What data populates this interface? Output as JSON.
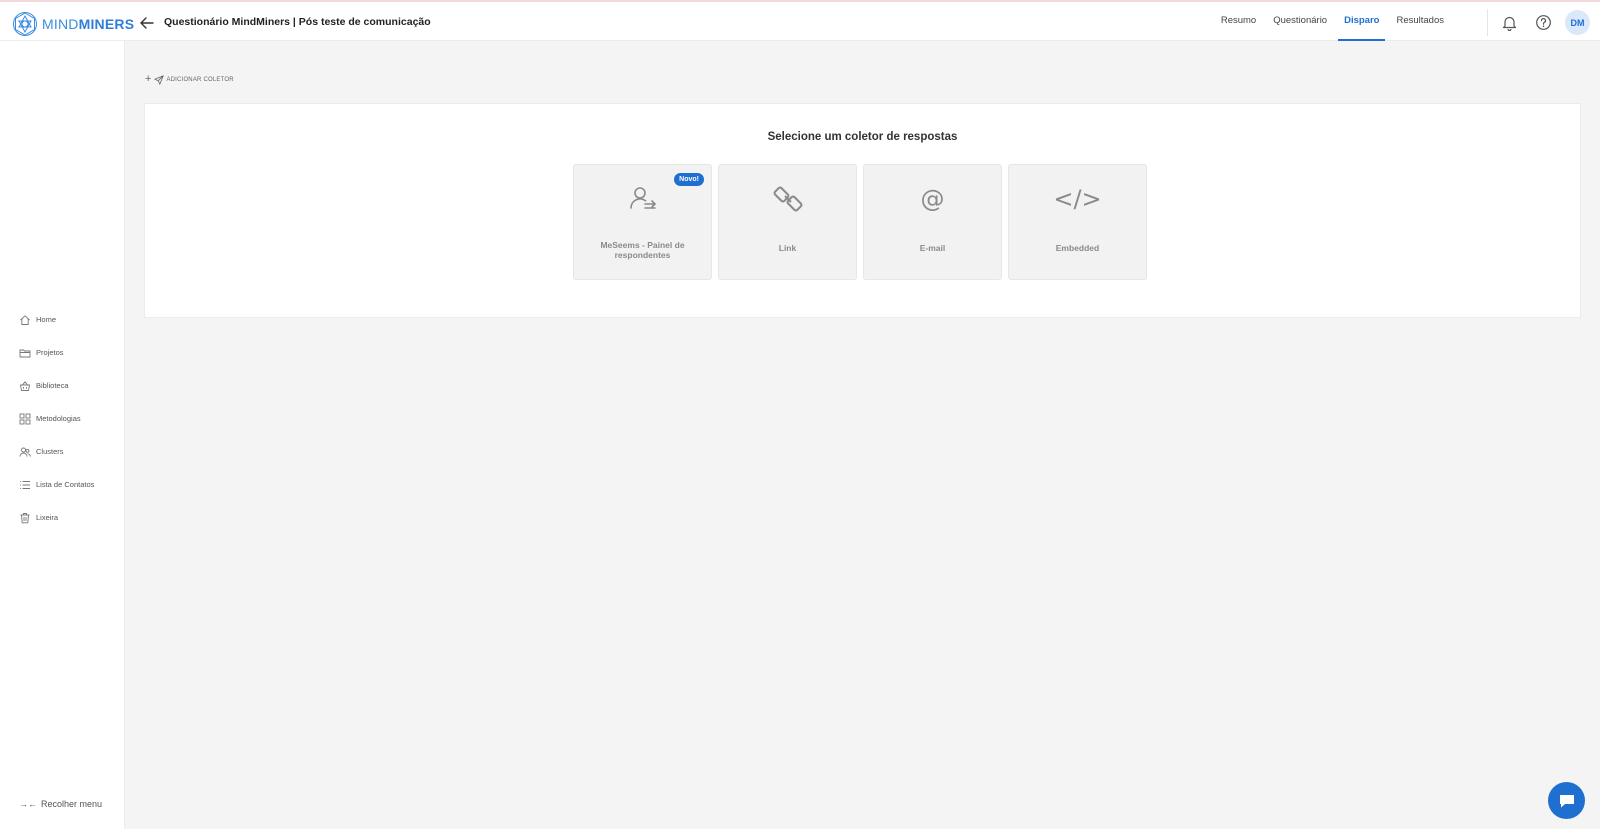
{
  "header": {
    "logo": {
      "text_light": "MIND",
      "text_bold": "MINERS",
      "icon": "geometric-logo-icon"
    },
    "back_icon": "arrow-left-icon",
    "title": "Questionário MindMiners | Pós teste de comunicação",
    "tabs": [
      {
        "label": "Resumo",
        "active": false
      },
      {
        "label": "Questionário",
        "active": false
      },
      {
        "label": "Disparo",
        "active": true
      },
      {
        "label": "Resultados",
        "active": false
      }
    ],
    "notification_icon": "bell-icon",
    "help_icon": "question-circle-icon",
    "avatar_initials": "DM"
  },
  "sidebar": {
    "items": [
      {
        "label": "Home",
        "icon": "home-icon"
      },
      {
        "label": "Projetos",
        "icon": "folder-icon"
      },
      {
        "label": "Biblioteca",
        "icon": "basket-icon"
      },
      {
        "label": "Metodologias",
        "icon": "grid-icon"
      },
      {
        "label": "Clusters",
        "icon": "users-icon"
      },
      {
        "label": "Lista de Contatos",
        "icon": "list-icon"
      },
      {
        "label": "Lixeira",
        "icon": "trash-icon"
      }
    ],
    "collapse_label": "Recolher menu",
    "collapse_icon": "→←"
  },
  "main": {
    "add_collector_label": "ADICIONAR COLETOR",
    "panel_title": "Selecione um coletor de respostas",
    "cards": [
      {
        "label": "MeSeems - Painel de respondentes",
        "icon": "user-panel-icon",
        "badge": "Novo!"
      },
      {
        "label": "Link",
        "icon": "chain-link-icon"
      },
      {
        "label": "E-mail",
        "icon": "at-sign-icon",
        "glyph": "@"
      },
      {
        "label": "Embedded",
        "icon": "code-icon",
        "glyph": "</>"
      }
    ]
  },
  "chat_icon": "chat-bubble-icon",
  "colors": {
    "accent": "#1f6fd1",
    "background": "#f4f4f4",
    "card": "#f2f2f2"
  }
}
